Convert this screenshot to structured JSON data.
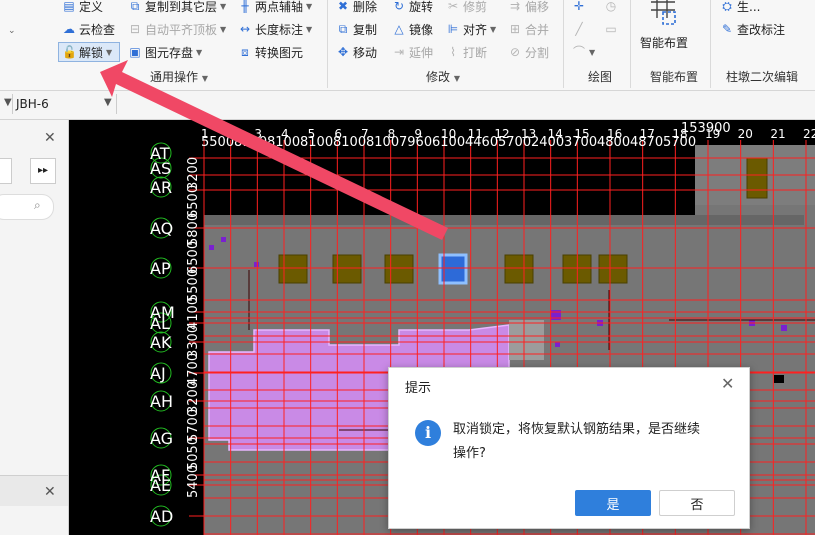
{
  "ribbon": {
    "col1": {
      "define": "定义",
      "cloud_check": "云检查",
      "unlock": "解锁"
    },
    "col2": {
      "copy_to_floor": "复制到其它层",
      "auto_flat_top": "自动平齐顶板",
      "component_save": "图元存盘"
    },
    "col3": {
      "two_point_axis": "两点辅轴",
      "length_label": "长度标注",
      "convert_component": "转换图元"
    },
    "modify": {
      "delete": "删除",
      "rotate": "旋转",
      "trim": "修剪",
      "offset": "偏移",
      "copy": "复制",
      "mirror": "镜像",
      "align": "对齐",
      "merge": "合并",
      "move": "移动",
      "extend": "延伸",
      "break": "打断",
      "split": "分割"
    },
    "smart_layout": {
      "label": "智能布置"
    },
    "pier_edit": {
      "row1": "生...",
      "view_label": "查改标注"
    },
    "groups": {
      "general_ops": "通用操作",
      "modify": "修改",
      "draw": "绘图",
      "smart_layout": "智能布置",
      "pier_edit": "柱墩二次编辑"
    }
  },
  "secondbar": {
    "component_name": "JBH-6"
  },
  "grid": {
    "top_labels": [
      "1",
      "2",
      "3",
      "4",
      "5",
      "6",
      "7",
      "8",
      "9",
      "10",
      "11",
      "12",
      "13",
      "14",
      "15",
      "16",
      "17",
      "18",
      "19",
      "20",
      "21",
      "22"
    ],
    "top_dims": [
      "5500",
      "8100",
      "8100",
      "8100",
      "8100",
      "8100",
      "7960",
      "6100",
      "4460",
      "5700",
      "2400",
      "3700",
      "4800",
      "4870",
      "5700",
      "153900"
    ],
    "left_labels": [
      "AT",
      "AS",
      "AR",
      "AQ",
      "AP",
      "AM",
      "AL",
      "AK",
      "AJ",
      "AH",
      "AG",
      "AF",
      "AE",
      "AD"
    ],
    "left_dims": [
      "3200",
      "6500",
      "5800",
      "6500",
      "5500",
      "4100",
      "3300",
      "4700",
      "3200",
      "5700",
      "5050",
      "5400"
    ]
  },
  "dialog": {
    "title": "提示",
    "message_line1": "取消锁定，将恢复默认钢筋结果，是否继续",
    "message_line2": "操作?",
    "yes": "是",
    "no": "否",
    "accent": "#2f7fdc",
    "info_icon": "info-icon",
    "close_icon": "close-icon"
  },
  "colors": {
    "axis_line": "#ff2020",
    "axis_text": "#ffffff",
    "bubble": "#22bb22",
    "slab_gray": "#767676",
    "pink_zone": "#c98ae6",
    "column_olive": "#6b5a00",
    "selected_blue": "#2d6ad8",
    "arrow": "#f04865"
  }
}
